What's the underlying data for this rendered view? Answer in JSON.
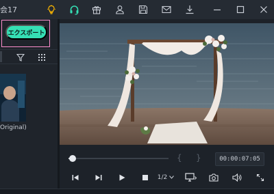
{
  "app": {
    "title_fragment": "会17"
  },
  "toolbar": {
    "icons": [
      "lightbulb-icon",
      "headset-icon",
      "gift-icon",
      "user-icon",
      "save-icon",
      "mail-icon",
      "download-icon",
      "minimize-icon",
      "maximize-icon",
      "close-icon"
    ],
    "accent_color": "#35dfb4",
    "highlight_color": "#ffb800"
  },
  "left_panel": {
    "export_label": "エクスポート",
    "export_color": "#35dfb4",
    "highlight_frame_color": "#ff8fcf",
    "clip_label": "Original)"
  },
  "player": {
    "timecode": "00:00:07:05",
    "progress": 0.04,
    "speed": "1/2",
    "in_bracket": "{",
    "out_bracket": "}"
  }
}
